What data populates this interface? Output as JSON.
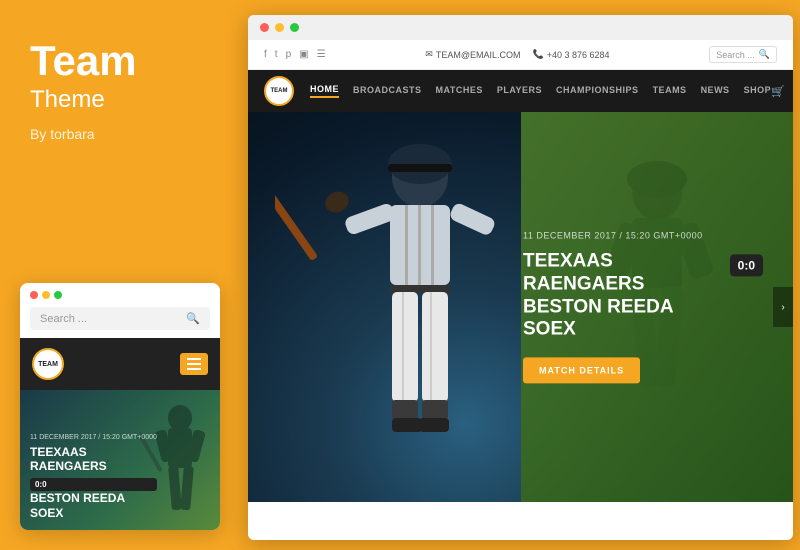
{
  "left": {
    "title": "Team",
    "subtitle": "Theme",
    "by": "By torbara"
  },
  "mobile": {
    "dots": [
      "red",
      "yellow",
      "green"
    ],
    "search_placeholder": "Search ...",
    "logo_text": "TEAM",
    "date": "11 DECEMBER 2017 / 15:20 GMT+0000",
    "team1": "TEEXAAS",
    "team2": "RAENGAERS",
    "team3": "BESTON REEDA",
    "team4": "SOEX",
    "score": "0:0"
  },
  "desktop": {
    "dots": [
      "red",
      "yellow",
      "green"
    ],
    "topbar": {
      "email": "TEAM@EMAIL.COM",
      "phone": "+40 3 876 6284",
      "search_placeholder": "Search ..."
    },
    "nav": {
      "logo_text": "TEAM",
      "links": [
        "HOME",
        "BROADCASTS",
        "MATCHES",
        "PLAYERS",
        "CHAMPIONSHIPS",
        "TEAMS",
        "NEWS",
        "SHOP"
      ],
      "active": "HOME"
    },
    "hero": {
      "date": "11 DECEMBER 2017 / 15:20 GMT+0000",
      "team1": "TEEXAAS RAENGAERS",
      "team2": "BESTON REEDA SOEX",
      "score": "0:0",
      "cta": "MATCH DETAILS"
    }
  }
}
